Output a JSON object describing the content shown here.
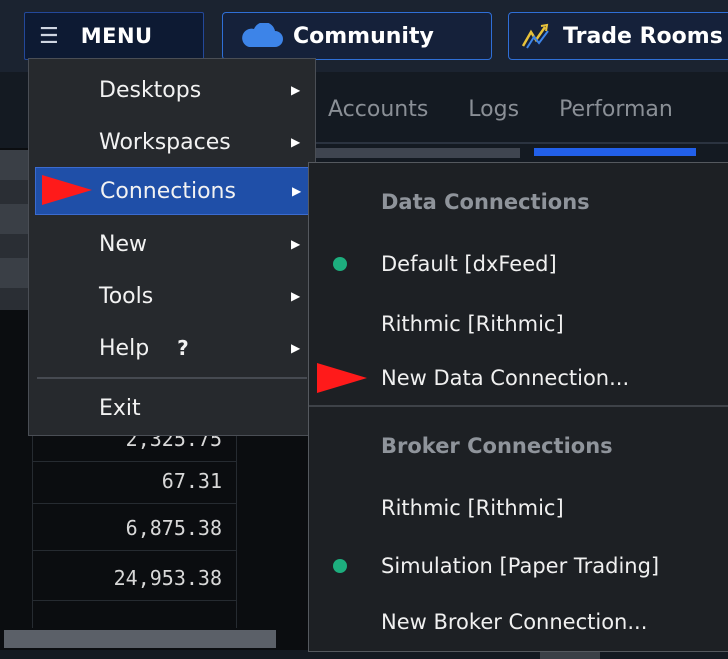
{
  "topbar": {
    "menu_label": "MENU",
    "community_label": "Community",
    "trade_rooms_label": "Trade Rooms"
  },
  "tabs": [
    "Accounts",
    "Logs",
    "Performan"
  ],
  "table": {
    "partial_value": "2,325.75",
    "values": [
      "67.31",
      "6,875.38",
      "24,953.38"
    ]
  },
  "main_menu": {
    "items": [
      {
        "label": "Desktops",
        "has_submenu": true
      },
      {
        "label": "Workspaces",
        "has_submenu": true
      },
      {
        "label": "Connections",
        "has_submenu": true,
        "active": true
      },
      {
        "label": "New",
        "has_submenu": true
      },
      {
        "label": "Tools",
        "has_submenu": true
      },
      {
        "label": "Help",
        "suffix": "?",
        "has_submenu": true
      },
      {
        "label": "Exit",
        "has_submenu": false
      }
    ]
  },
  "connections_submenu": {
    "data_header": "Data Connections",
    "data_items": [
      {
        "label": "Default [dxFeed]",
        "connected": true
      },
      {
        "label": "Rithmic [Rithmic]",
        "connected": false
      },
      {
        "label": "New Data Connection...",
        "connected": false
      }
    ],
    "broker_header": "Broker Connections",
    "broker_items": [
      {
        "label": "Rithmic [Rithmic]",
        "connected": false
      },
      {
        "label": "Simulation [Paper Trading]",
        "connected": true
      },
      {
        "label": "New Broker Connection...",
        "connected": false
      }
    ]
  },
  "colors": {
    "accent": "#1f4fa8",
    "connected_dot": "#1dae7e",
    "pointer": "#ff1a1a"
  },
  "icons": {
    "menu": "hamburger-icon",
    "community": "cloud-icon",
    "trade_rooms": "chart-trend-icon",
    "submenu_arrow": "caret-right-icon"
  }
}
